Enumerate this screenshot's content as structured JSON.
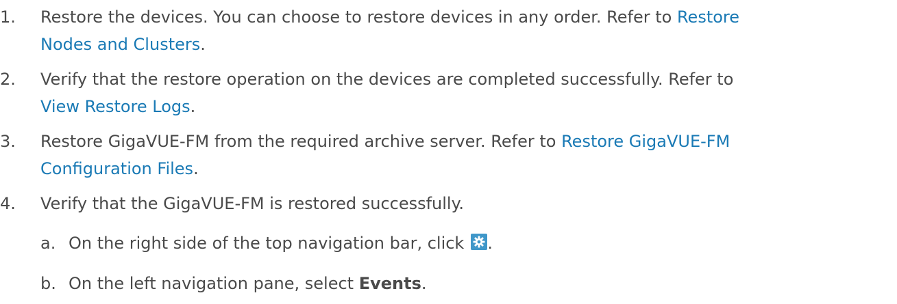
{
  "steps": [
    {
      "number": "1.",
      "text": "Restore the devices. You can choose to restore devices in any order. Refer to ",
      "link": "Restore Nodes and Clusters",
      "link_line1": "Restore",
      "link_line2": "Nodes and Clusters",
      "suffix": "."
    },
    {
      "number": "2.",
      "text": "Verify that the restore operation on the devices are completed successfully. Refer to",
      "link": "View Restore Logs",
      "suffix": "."
    },
    {
      "number": "3.",
      "text": "Restore GigaVUE-FM from the required archive server. Refer to ",
      "link_line1": "Restore GigaVUE-FM",
      "link_line2": "Configuration Files",
      "suffix": "."
    },
    {
      "number": "4.",
      "text": "Verify that the GigaVUE-FM is restored successfully."
    }
  ],
  "substeps": [
    {
      "letter": "a.",
      "text": "On the right side of the top navigation bar, click",
      "icon": "gear-icon",
      "suffix": "."
    },
    {
      "letter": "b.",
      "text": "On the left navigation pane, select ",
      "bold": "Events",
      "suffix": "."
    }
  ],
  "colors": {
    "text": "#4a4a4a",
    "link": "#1a7ab5",
    "icon_bg": "#3f97c9"
  }
}
